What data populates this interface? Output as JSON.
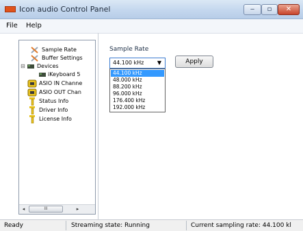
{
  "window": {
    "title": "Icon audio Control Panel"
  },
  "menu": [
    {
      "label": "File"
    },
    {
      "label": "Help"
    }
  ],
  "tree": {
    "items": [
      {
        "label": "Sample Rate",
        "icon": "wrench-icon"
      },
      {
        "label": "Buffer Settings",
        "icon": "wrench-icon"
      },
      {
        "label": "Devices",
        "icon": "device-icon",
        "expander": "⊟"
      },
      {
        "label": "iKeyboard 5",
        "icon": "device-icon"
      },
      {
        "label": "ASIO IN Channe",
        "icon": "channel-icon"
      },
      {
        "label": "ASIO OUT Chan",
        "icon": "channel-icon"
      },
      {
        "label": "Status Info",
        "icon": "info-icon"
      },
      {
        "label": "Driver Info",
        "icon": "info-icon"
      },
      {
        "label": "License Info",
        "icon": "info-icon"
      }
    ],
    "scroll_left": "◂",
    "scroll_right": "▸",
    "scroll_thumb": "III"
  },
  "sample_rate": {
    "group_label": "Sample Rate",
    "selected": "44.100 kHz",
    "apply_label": "Apply",
    "options": [
      "44.100 kHz",
      "48.000 kHz",
      "88.200 kHz",
      "96.000 kHz",
      "176.400 kHz",
      "192.000 kHz"
    ]
  },
  "status": {
    "ready": "Ready",
    "streaming": "Streaming state: Running",
    "current_rate": "Current sampling rate: 44.100 kl"
  },
  "colors": {
    "highlight": "#3399ff",
    "app_icon": "#e0531c"
  }
}
